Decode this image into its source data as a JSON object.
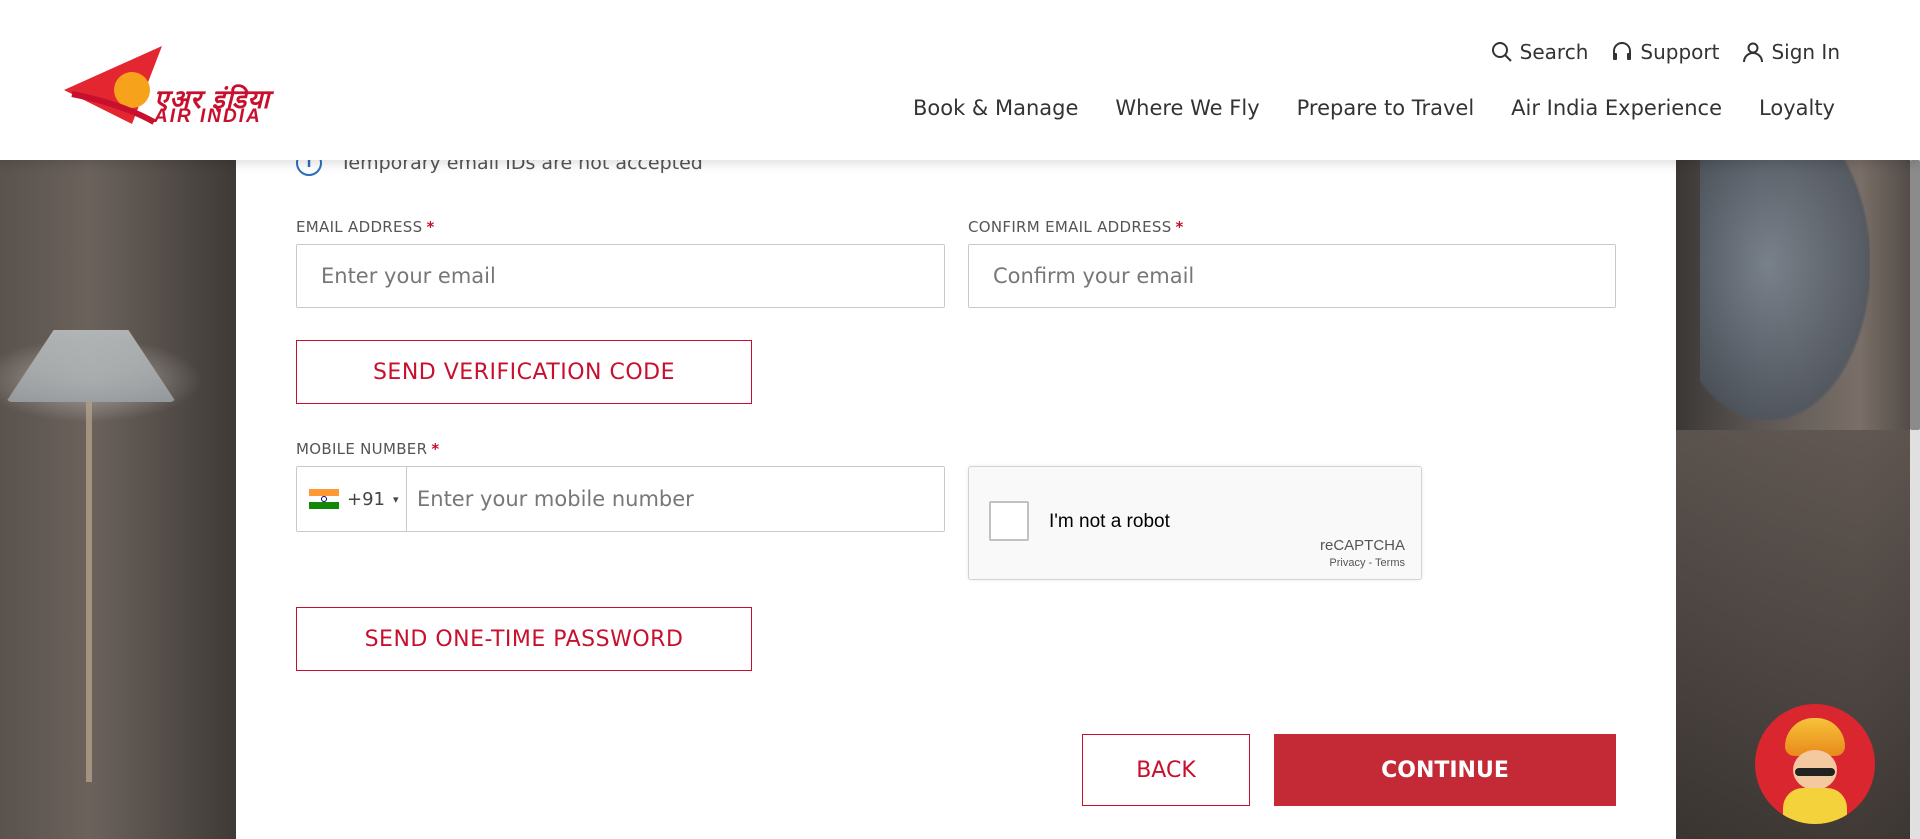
{
  "header": {
    "logo": {
      "hindi": "एअर इंडिया",
      "english": "AIR INDIA"
    },
    "utility_nav": [
      {
        "label": "Search",
        "icon": "search-icon"
      },
      {
        "label": "Support",
        "icon": "headset-icon"
      },
      {
        "label": "Sign In",
        "icon": "user-icon"
      }
    ],
    "main_nav": [
      "Book & Manage",
      "Where We Fly",
      "Prepare to Travel",
      "Air India Experience",
      "Loyalty"
    ]
  },
  "form": {
    "temp_email_note": "Temporary email IDs are not accepted",
    "email": {
      "label": "EMAIL ADDRESS",
      "required": "*",
      "placeholder": "Enter your email"
    },
    "confirm_email": {
      "label": "CONFIRM EMAIL ADDRESS",
      "required": "*",
      "placeholder": "Confirm your email"
    },
    "send_verification_label": "SEND VERIFICATION CODE",
    "mobile": {
      "label": "MOBILE NUMBER",
      "required": "*",
      "country_code": "+91",
      "caret": "▾",
      "placeholder": "Enter your mobile number"
    },
    "captcha": {
      "label": "I'm not a robot",
      "brand": "reCAPTCHA",
      "links": "Privacy - Terms"
    },
    "send_otp_label": "SEND ONE-TIME PASSWORD",
    "back_label": "BACK",
    "continue_label": "CONTINUE"
  },
  "colors": {
    "brand_red": "#c8102e",
    "continue_bg": "#c32a35",
    "info_blue": "#2a6fc0"
  }
}
